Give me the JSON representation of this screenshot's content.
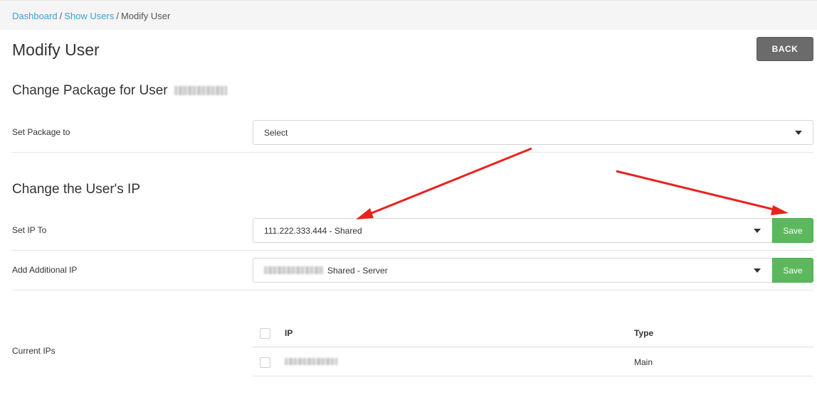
{
  "breadcrumb": {
    "items": [
      "Dashboard",
      "Show Users"
    ],
    "separator": "/",
    "current": "Modify User"
  },
  "page_title": "Modify User",
  "back_button": "BACK",
  "package_section": {
    "title": "Change Package for User",
    "set_package_label": "Set Package to",
    "select_value": "Select"
  },
  "ip_section": {
    "title": "Change the User's IP",
    "set_ip_label": "Set IP To",
    "set_ip_value": "111.222.333.444 - Shared",
    "save_label": "Save",
    "additional_ip_label": "Add Additional IP",
    "additional_ip_value_suffix": "Shared - Server",
    "additional_save_label": "Save"
  },
  "current_ips": {
    "label": "Current IPs",
    "columns": [
      "IP",
      "Type"
    ],
    "rows": [
      {
        "type": "Main"
      }
    ]
  },
  "colors": {
    "link": "#3aa1d8",
    "save_green": "#5cb85c",
    "back_gray": "#6b6b6b",
    "arrow_red": "#e8231f"
  }
}
